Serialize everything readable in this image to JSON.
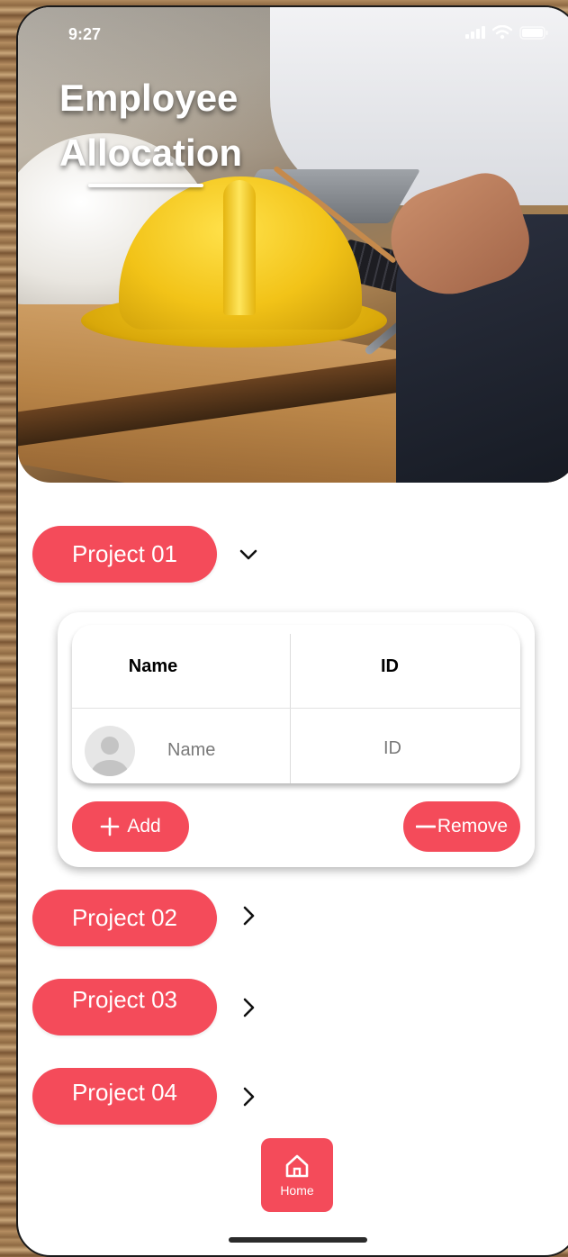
{
  "status_bar": {
    "time": "9:27"
  },
  "header": {
    "title_line1": "Employee",
    "title_line2": "Allocation"
  },
  "projects": [
    {
      "label": "Project 01",
      "expanded": true
    },
    {
      "label": "Project 02",
      "expanded": false
    },
    {
      "label": "Project 03",
      "expanded": false
    },
    {
      "label": "Project 04",
      "expanded": false
    }
  ],
  "allocation_table": {
    "columns": [
      "Name",
      "ID"
    ],
    "rows": [
      {
        "name": "Name",
        "id": "ID"
      }
    ]
  },
  "actions": {
    "add_label": "Add",
    "remove_label": "Remove"
  },
  "nav": {
    "home_label": "Home"
  },
  "colors": {
    "accent": "#f44b5a",
    "background": "#ffffff"
  },
  "icons": [
    "signal-icon",
    "wifi-icon",
    "battery-icon",
    "chevron-down-icon",
    "chevron-right-icon",
    "avatar-icon",
    "plus-icon",
    "minus-icon",
    "home-icon"
  ]
}
